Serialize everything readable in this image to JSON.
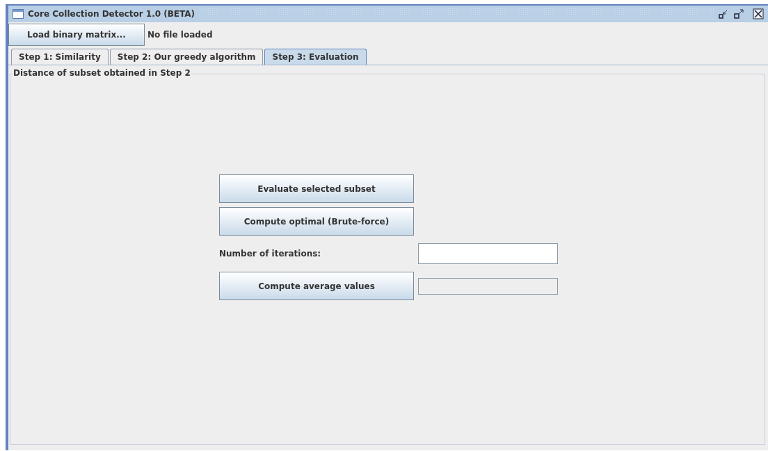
{
  "window": {
    "title": "Core Collection Detector 1.0 (BETA)"
  },
  "toolbar": {
    "load_button": "Load binary matrix...",
    "status": "No file loaded"
  },
  "tabs": [
    {
      "label": "Step 1: Similarity",
      "selected": false
    },
    {
      "label": "Step 2: Our greedy algorithm",
      "selected": false
    },
    {
      "label": "Step 3: Evaluation",
      "selected": true
    }
  ],
  "panel": {
    "title": "Distance of subset obtained in Step 2",
    "evaluate_button": "Evaluate selected subset",
    "optimal_button": "Compute optimal (Brute-force)",
    "iterations_label": "Number of iterations:",
    "iterations_field": {
      "disabled": false
    },
    "average_button": "Compute average values",
    "average_field": {
      "disabled": true
    }
  }
}
